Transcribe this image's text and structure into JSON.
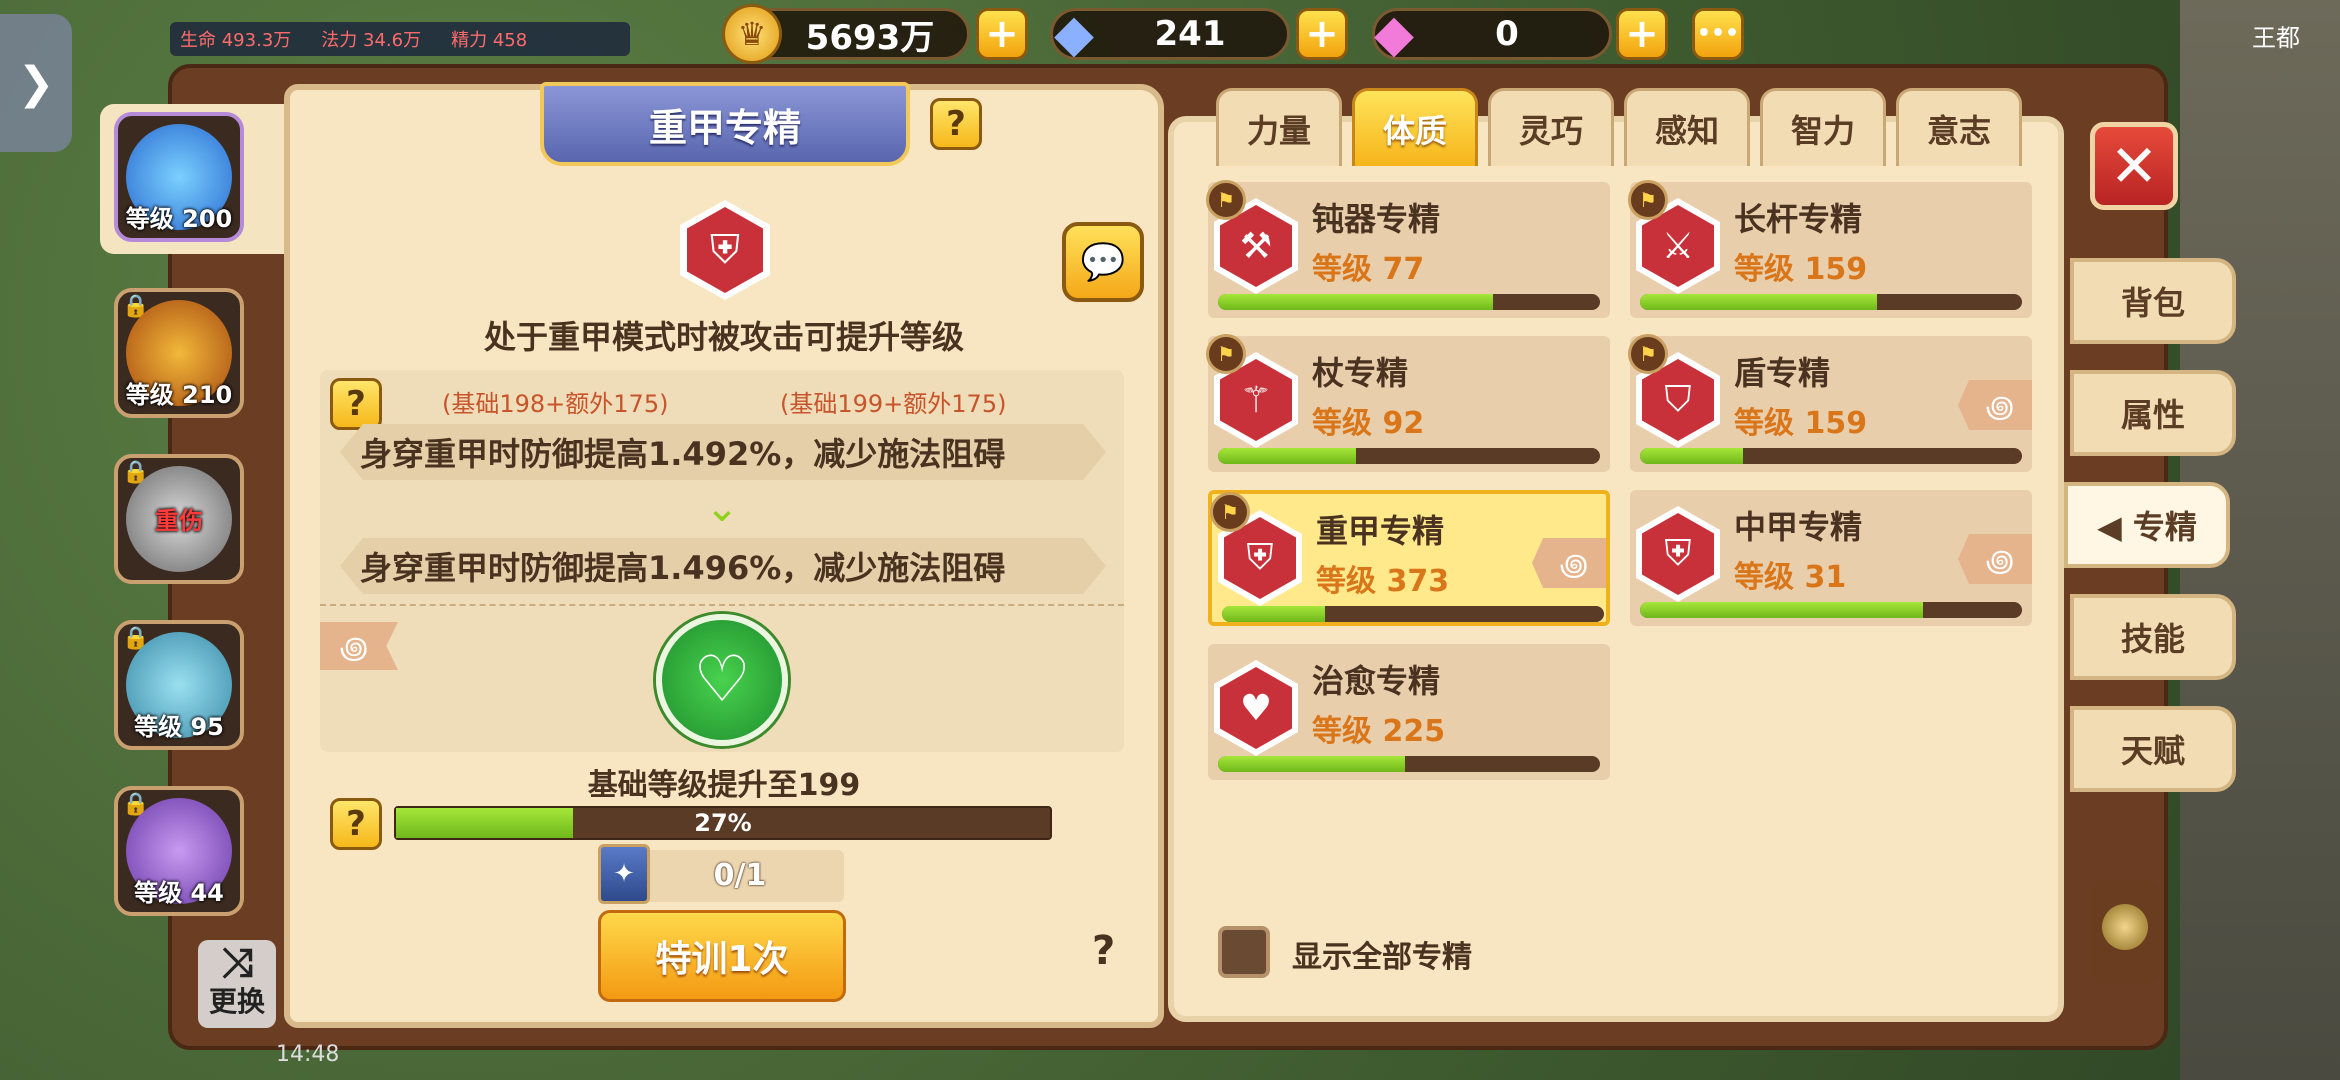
{
  "top": {
    "stats": {
      "hp_label": "生命",
      "hp": "493.3万",
      "mag_label": "法力",
      "mag": "34.6万",
      "spirit_label": "精力",
      "spirit": "458"
    },
    "gold": "5693万",
    "diamond": "241",
    "gem": "0",
    "more": "•••",
    "location": "王都"
  },
  "characters": [
    {
      "level": "等级 200"
    },
    {
      "level": "等级 210"
    },
    {
      "level": "",
      "status": "重伤"
    },
    {
      "level": "等级 95"
    },
    {
      "level": "等级 44"
    }
  ],
  "swap_label": "更换",
  "time": "14:48",
  "detail": {
    "title": "重甲专精",
    "description": "处于重甲模式时被攻击可提升等级",
    "bonus_current": "(基础198+额外175)",
    "bonus_next": "(基础199+额外175)",
    "effect_current": "身穿重甲时防御提高1.492%，减少施法阻碍",
    "effect_next": "身穿重甲时防御提高1.496%，减少施法阻碍",
    "base_level_up": "基础等级提升至199",
    "progress_text": "27%",
    "progress": 0.27,
    "item_count": "0/1",
    "train_button": "特训1次",
    "help": "?"
  },
  "tabs": [
    "力量",
    "体质",
    "灵巧",
    "感知",
    "智力",
    "意志"
  ],
  "active_tab": "体质",
  "specs": [
    {
      "name": "钝器专精",
      "level": "等级 77",
      "progress": 0.72,
      "icon": "hammer-icon",
      "flag": true,
      "swirl": false
    },
    {
      "name": "长杆专精",
      "level": "等级 159",
      "progress": 0.62,
      "icon": "polearm-icon",
      "flag": true,
      "swirl": false
    },
    {
      "name": "杖专精",
      "level": "等级 92",
      "progress": 0.36,
      "icon": "staff-icon",
      "flag": true,
      "swirl": false
    },
    {
      "name": "盾专精",
      "level": "等级 159",
      "progress": 0.27,
      "icon": "shield-icon",
      "flag": true,
      "swirl": true
    },
    {
      "name": "重甲专精",
      "level": "等级 373",
      "progress": 0.27,
      "icon": "heavy-armor-icon",
      "flag": true,
      "swirl": true,
      "selected": true
    },
    {
      "name": "中甲专精",
      "level": "等级 31",
      "progress": 0.74,
      "icon": "medium-armor-icon",
      "flag": false,
      "swirl": true
    },
    {
      "name": "治愈专精",
      "level": "等级 225",
      "progress": 0.49,
      "icon": "heal-icon",
      "flag": false,
      "swirl": false
    }
  ],
  "show_all_label": "显示全部专精",
  "side_menu": [
    "背包",
    "属性",
    "专精",
    "技能",
    "天赋"
  ],
  "active_side": "专精",
  "colors": {
    "accent": "#f6b51a",
    "bar": "#8fd22a",
    "frame": "#6b3d22",
    "page": "#f7e6c1",
    "red": "#c8313a"
  }
}
